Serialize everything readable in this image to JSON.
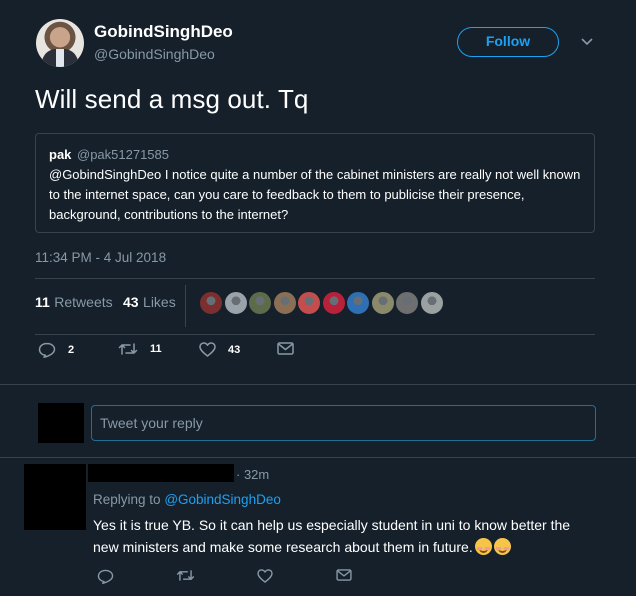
{
  "author": {
    "name": "GobindSinghDeo",
    "handle": "@GobindSinghDeo"
  },
  "follow_button": "Follow",
  "tweet": {
    "text": "Will send a msg out. Tq",
    "timestamp": "11:34 PM - 4 Jul 2018"
  },
  "quoted_tweet": {
    "name": "pak",
    "handle": "@pak51271585",
    "text": "@GobindSinghDeo I notice quite a number of the cabinet ministers are really not well known to the internet space, can you care to feedback to them to publicise their presence, background, contributions to the internet?"
  },
  "stats": {
    "retweets_count": "11",
    "retweets_label": "Retweets",
    "likes_count": "43",
    "likes_label": "Likes"
  },
  "liker_avatars": [
    "#7b2f2f",
    "#9aa3a9",
    "#5d6b4a",
    "#8a6f55",
    "#c44e4e",
    "#b8213a",
    "#2f6fb3",
    "#8a8a6a",
    "#6f6f6f",
    "#9ba0a0"
  ],
  "actions": {
    "replies": "2",
    "retweets": "11",
    "likes": "43"
  },
  "reply_box": {
    "placeholder": "Tweet your reply"
  },
  "reply": {
    "time": "· 32m",
    "replying_prefix": "Replying to",
    "replying_to": "@GobindSinghDeo",
    "text": "Yes it is true YB. So it can help us especially student in uni to know better the new ministers and make some research about them in future."
  },
  "colors": {
    "background": "#15202b",
    "accent": "#1da1f2",
    "muted": "#8899a6",
    "border": "#38444d"
  }
}
